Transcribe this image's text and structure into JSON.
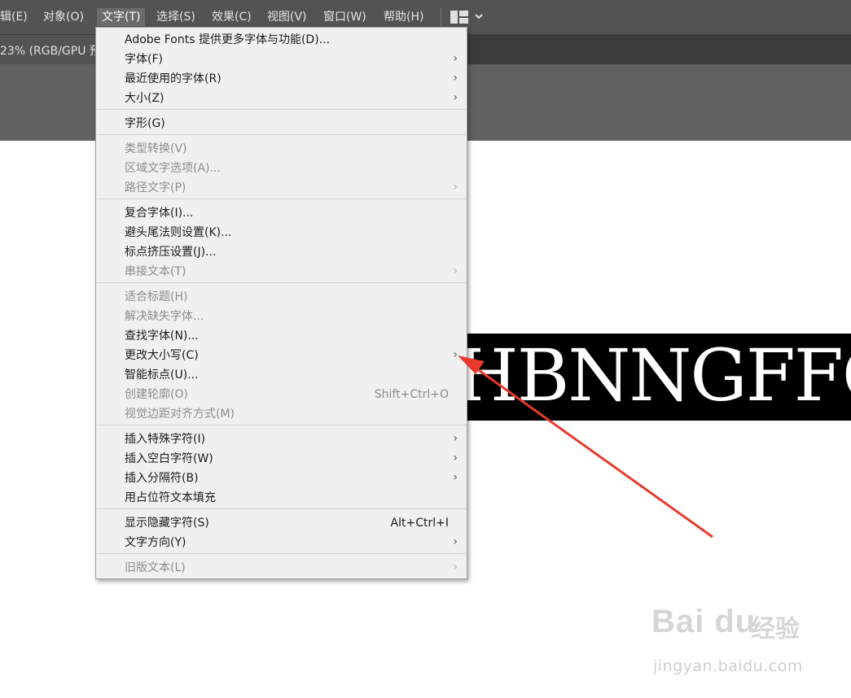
{
  "menubar": {
    "items": [
      "辑(E)",
      "对象(O)",
      "文字(T)",
      "选择(S)",
      "效果(C)",
      "视图(V)",
      "窗口(W)",
      "帮助(H)"
    ],
    "active_index": 2,
    "workspace_icon": "workspace-layout-icon",
    "workspace_chevron": "chevron-down-icon"
  },
  "document": {
    "tab_label": "23% (RGB/GPU 预"
  },
  "canvas": {
    "text": "HBNNGFFGE",
    "bg_color": "#000000",
    "text_color": "#ffffff"
  },
  "type_menu": {
    "items": [
      {
        "label": "Adobe Fonts 提供更多字体与功能(D)...",
        "enabled": true
      },
      {
        "label": "字体(F)",
        "enabled": true,
        "submenu": true
      },
      {
        "label": "最近使用的字体(R)",
        "enabled": true,
        "submenu": true
      },
      {
        "label": "大小(Z)",
        "enabled": true,
        "submenu": true
      },
      {
        "label": "字形(G)",
        "enabled": true
      },
      {
        "label": "类型转换(V)",
        "enabled": false
      },
      {
        "label": "区域文字选项(A)...",
        "enabled": false
      },
      {
        "label": "路径文字(P)",
        "enabled": false,
        "submenu": true
      },
      {
        "label": "复合字体(I)...",
        "enabled": true
      },
      {
        "label": "避头尾法则设置(K)...",
        "enabled": true
      },
      {
        "label": "标点挤压设置(J)...",
        "enabled": true
      },
      {
        "label": "串接文本(T)",
        "enabled": false,
        "submenu": true
      },
      {
        "label": "适合标题(H)",
        "enabled": false
      },
      {
        "label": "解决缺失字体...",
        "enabled": false
      },
      {
        "label": "查找字体(N)...",
        "enabled": true
      },
      {
        "label": "更改大小写(C)",
        "enabled": true,
        "submenu": true
      },
      {
        "label": "智能标点(U)...",
        "enabled": true
      },
      {
        "label": "创建轮廓(O)",
        "enabled": false,
        "shortcut": "Shift+Ctrl+O"
      },
      {
        "label": "视觉边距对齐方式(M)",
        "enabled": false
      },
      {
        "label": "插入特殊字符(I)",
        "enabled": true,
        "submenu": true
      },
      {
        "label": "插入空白字符(W)",
        "enabled": true,
        "submenu": true
      },
      {
        "label": "插入分隔符(B)",
        "enabled": true,
        "submenu": true
      },
      {
        "label": "用占位符文本填充",
        "enabled": true
      },
      {
        "label": "显示隐藏字符(S)",
        "enabled": true,
        "shortcut": "Alt+Ctrl+I"
      },
      {
        "label": "文字方向(Y)",
        "enabled": true,
        "submenu": true
      },
      {
        "label": "旧版文本(L)",
        "enabled": false,
        "submenu": true
      }
    ],
    "arrow_glyph": "›"
  },
  "annotation": {
    "color": "#e8392f",
    "points_to": "更改大小写(C)"
  },
  "watermark": {
    "logo": "Bai du",
    "cn": "经验",
    "url": "jingyan.baidu.com"
  }
}
